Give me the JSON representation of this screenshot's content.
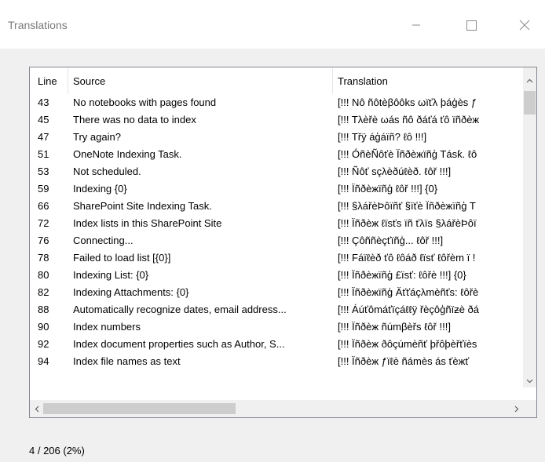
{
  "window": {
    "title": "Translations"
  },
  "columns": {
    "line": "Line",
    "source": "Source",
    "translation": "Translation"
  },
  "rows": [
    {
      "line": "43",
      "source": "No notebooks with pages found",
      "translation": "[!!! Nô ñôtèβôôkѕ ωïťλ þáģèѕ ƒ"
    },
    {
      "line": "45",
      "source": "There was no data to index",
      "translation": "[!!! Tλèřè ωáѕ ñô ðáťá ťô ïñðèж"
    },
    {
      "line": "47",
      "source": "Try again?",
      "translation": "[!!! Třÿ áģáïñ? ℓô !!!]"
    },
    {
      "line": "51",
      "source": "OneNote Indexing Task.",
      "translation": "[!!! ÓñèÑôťè Ïñðèжïñģ Táѕƙ. ℓô"
    },
    {
      "line": "53",
      "source": "Not scheduled.",
      "translation": "[!!! Ñôť ѕçλèðúℓèð. ℓôř !!!]"
    },
    {
      "line": "59",
      "source": "Indexing {0}",
      "translation": "[!!! Ïñðèжïñģ ℓôř !!!] {0}"
    },
    {
      "line": "66",
      "source": "SharePoint Site Indexing Task.",
      "translation": "[!!! §λářèÞôïñť §ïťè Ïñðèжïñģ T"
    },
    {
      "line": "72",
      "source": "Index lists in this SharePoint Site",
      "translation": "[!!! Ïñðèж ℓïѕťѕ ïñ ťλïѕ §λářèÞôï"
    },
    {
      "line": "76",
      "source": "Connecting...",
      "translation": "[!!! Çôññèçťïñģ... ℓôř !!!]"
    },
    {
      "line": "78",
      "source": "Failed to load list [{0}]",
      "translation": "[!!! Fáïℓèð ťô ℓôáð ℓïѕť ℓôřèm ï !"
    },
    {
      "line": "80",
      "source": "Indexing List: {0}",
      "translation": "[!!! Ïñðèжïñģ £ïѕť: ℓôřè !!!] {0}"
    },
    {
      "line": "82",
      "source": "Indexing Attachments: {0}",
      "translation": "[!!! Ïñðèжïñģ Äťťáçλmèñťѕ: ℓôřè"
    },
    {
      "line": "88",
      "source": "Automatically recognize dates, email address...",
      "translation": "[!!! Áúťômáťïçáℓℓÿ řèçôģñïƶè ðá"
    },
    {
      "line": "90",
      "source": "Index numbers",
      "translation": "[!!! Ïñðèж ñúmβèřѕ ℓôř !!!]"
    },
    {
      "line": "92",
      "source": "Index document properties such as Author, S...",
      "translation": "[!!! Ïñðèж ðôçúmèñť þřôþèřťïèѕ"
    },
    {
      "line": "94",
      "source": "Index file names as text",
      "translation": "[!!! Ïñðèж ƒïℓè ñámèѕ áѕ ťèжť"
    }
  ],
  "status": {
    "progress_text": "4 / 206 (2%)"
  }
}
